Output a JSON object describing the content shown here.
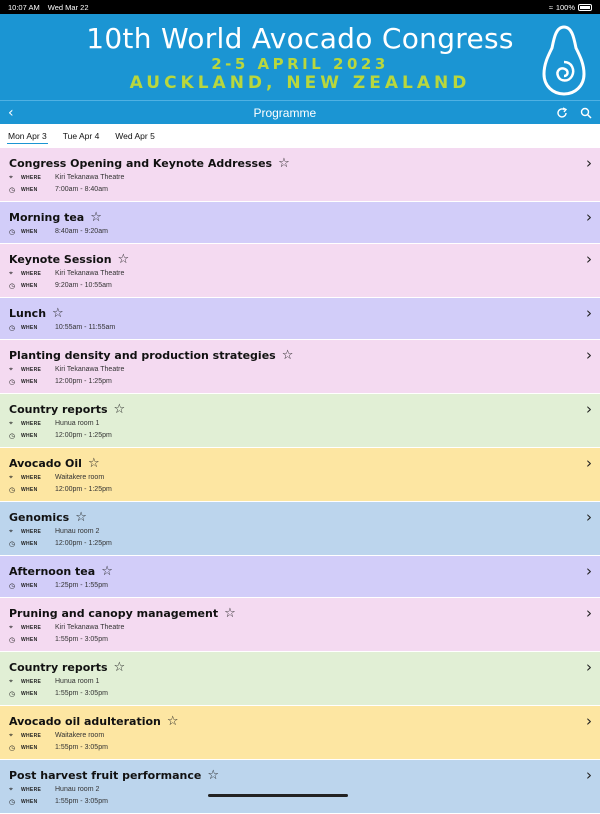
{
  "status": {
    "time": "10:07 AM",
    "date": "Wed Mar 22",
    "battery": "100%"
  },
  "banner": {
    "title": "10th World Avocado Congress",
    "dates": "2-5 APRIL 2023",
    "location": "AUCKLAND, NEW ZEALAND"
  },
  "nav": {
    "title": "Programme",
    "back_icon": "chevron-left-icon",
    "refresh_icon": "refresh-icon",
    "search_icon": "search-icon"
  },
  "tabs": [
    {
      "label": "Mon Apr 3",
      "active": true
    },
    {
      "label": "Tue Apr 4",
      "active": false
    },
    {
      "label": "Wed Apr 5",
      "active": false
    }
  ],
  "labels": {
    "where": "WHERE",
    "when": "WHEN"
  },
  "colors": {
    "pink": "#f4daf1",
    "lavender": "#d2cdf9",
    "green": "#e1efd5",
    "yellow": "#fde6a2",
    "blue": "#bcd5ed",
    "brand": "#1b95d3",
    "accent": "#b9d73d"
  },
  "sessions": [
    {
      "title": "Congress Opening and Keynote Addresses",
      "where": "Kiri Tekanawa Theatre",
      "when": "7:00am - 8:40am",
      "color": "#f4daf1"
    },
    {
      "title": "Morning tea",
      "where": "",
      "when": "8:40am - 9:20am",
      "color": "#d2cdf9"
    },
    {
      "title": "Keynote Session",
      "where": "Kiri Tekanawa Theatre",
      "when": "9:20am - 10:55am",
      "color": "#f4daf1"
    },
    {
      "title": "Lunch",
      "where": "",
      "when": "10:55am - 11:55am",
      "color": "#d2cdf9"
    },
    {
      "title": "Planting density and production strategies",
      "where": "Kiri Tekanawa Theatre",
      "when": "12:00pm - 1:25pm",
      "color": "#f4daf1"
    },
    {
      "title": "Country reports",
      "where": "Hunua room 1",
      "when": "12:00pm - 1:25pm",
      "color": "#e1efd5"
    },
    {
      "title": "Avocado Oil",
      "where": "Waitakere room",
      "when": "12:00pm - 1:25pm",
      "color": "#fde6a2"
    },
    {
      "title": "Genomics",
      "where": "Hunau room 2",
      "when": "12:00pm - 1:25pm",
      "color": "#bcd5ed"
    },
    {
      "title": "Afternoon tea",
      "where": "",
      "when": "1:25pm - 1:55pm",
      "color": "#d2cdf9"
    },
    {
      "title": "Pruning and canopy management",
      "where": "Kiri Tekanawa Theatre",
      "when": "1:55pm - 3:05pm",
      "color": "#f4daf1"
    },
    {
      "title": "Country reports",
      "where": "Hunua room 1",
      "when": "1:55pm - 3:05pm",
      "color": "#e1efd5"
    },
    {
      "title": "Avocado oil adulteration",
      "where": "Waitakere room",
      "when": "1:55pm - 3:05pm",
      "color": "#fde6a2"
    },
    {
      "title": "Post harvest fruit performance",
      "where": "Hunau room 2",
      "when": "1:55pm - 3:05pm",
      "color": "#bcd5ed"
    }
  ]
}
